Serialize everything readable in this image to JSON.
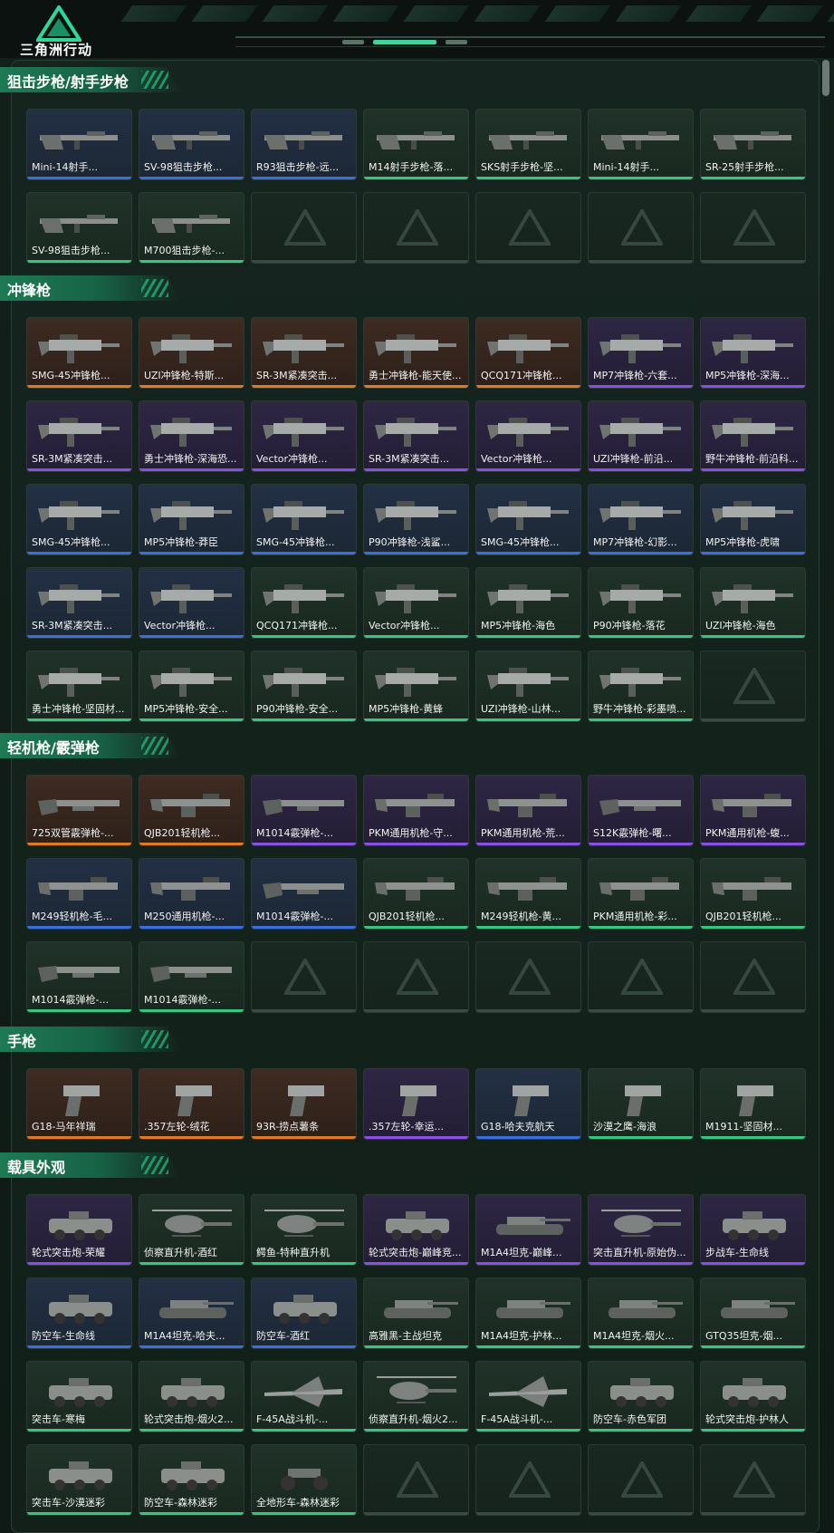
{
  "brand": {
    "logo_text": "三角洲行动"
  },
  "colors": {
    "blue": "#3b6fe0",
    "purple": "#8a50e6",
    "orange": "#e07a25",
    "green": "#39c47f",
    "accent": "#41d39a"
  },
  "sections": [
    {
      "title": "狙击步枪/射手步枪",
      "items": [
        {
          "label": "Mini-14射手...",
          "rarity": "blue",
          "icon": "rifle-icon"
        },
        {
          "label": "SV-98狙击步枪...",
          "rarity": "blue",
          "icon": "rifle-icon"
        },
        {
          "label": "R93狙击步枪-远...",
          "rarity": "blue",
          "icon": "rifle-icon"
        },
        {
          "label": "M14射手步枪-落...",
          "rarity": "green",
          "icon": "rifle-icon"
        },
        {
          "label": "SKS射手步枪-坚...",
          "rarity": "green",
          "icon": "rifle-icon"
        },
        {
          "label": "Mini-14射手...",
          "rarity": "green",
          "icon": "rifle-icon"
        },
        {
          "label": "SR-25射手步枪...",
          "rarity": "green",
          "icon": "rifle-icon"
        },
        {
          "label": "SV-98狙击步枪...",
          "rarity": "green",
          "icon": "rifle-icon"
        },
        {
          "label": "M700狙击步枪-...",
          "rarity": "green",
          "icon": "rifle-icon"
        }
      ]
    },
    {
      "title": "冲锋枪",
      "items": [
        {
          "label": "SMG-45冲锋枪...",
          "rarity": "orange",
          "icon": "smg-icon"
        },
        {
          "label": "UZI冲锋枪-特斯...",
          "rarity": "orange",
          "icon": "smg-icon"
        },
        {
          "label": "SR-3M紧凑突击...",
          "rarity": "orange",
          "icon": "smg-icon"
        },
        {
          "label": "勇士冲锋枪-能天使...",
          "rarity": "orange",
          "icon": "smg-icon"
        },
        {
          "label": "QCQ171冲锋枪...",
          "rarity": "orange",
          "icon": "smg-icon"
        },
        {
          "label": "MP7冲锋枪-六套...",
          "rarity": "purple",
          "icon": "smg-icon"
        },
        {
          "label": "MP5冲锋枪-深海...",
          "rarity": "purple",
          "icon": "smg-icon"
        },
        {
          "label": "SR-3M紧凑突击...",
          "rarity": "purple",
          "icon": "smg-icon"
        },
        {
          "label": "勇士冲锋枪-深海恐...",
          "rarity": "purple",
          "icon": "smg-icon"
        },
        {
          "label": "Vector冲锋枪...",
          "rarity": "purple",
          "icon": "smg-icon"
        },
        {
          "label": "SR-3M紧凑突击...",
          "rarity": "purple",
          "icon": "smg-icon"
        },
        {
          "label": "Vector冲锋枪...",
          "rarity": "purple",
          "icon": "smg-icon"
        },
        {
          "label": "UZI冲锋枪-前沿...",
          "rarity": "purple",
          "icon": "smg-icon"
        },
        {
          "label": "野牛冲锋枪-前沿科...",
          "rarity": "purple",
          "icon": "smg-icon"
        },
        {
          "label": "SMG-45冲锋枪...",
          "rarity": "blue",
          "icon": "smg-icon"
        },
        {
          "label": "MP5冲锋枪-莽臣",
          "rarity": "blue",
          "icon": "smg-icon"
        },
        {
          "label": "SMG-45冲锋枪...",
          "rarity": "blue",
          "icon": "smg-icon"
        },
        {
          "label": "P90冲锋枪-浅鲨...",
          "rarity": "blue",
          "icon": "smg-icon"
        },
        {
          "label": "SMG-45冲锋枪...",
          "rarity": "blue",
          "icon": "smg-icon"
        },
        {
          "label": "MP7冲锋枪-幻影...",
          "rarity": "blue",
          "icon": "smg-icon"
        },
        {
          "label": "MP5冲锋枪-虎啸",
          "rarity": "blue",
          "icon": "smg-icon"
        },
        {
          "label": "SR-3M紧凑突击...",
          "rarity": "blue",
          "icon": "smg-icon"
        },
        {
          "label": "Vector冲锋枪...",
          "rarity": "blue",
          "icon": "smg-icon"
        },
        {
          "label": "QCQ171冲锋枪...",
          "rarity": "green",
          "icon": "smg-icon"
        },
        {
          "label": "Vector冲锋枪...",
          "rarity": "green",
          "icon": "smg-icon"
        },
        {
          "label": "MP5冲锋枪-海色",
          "rarity": "green",
          "icon": "smg-icon"
        },
        {
          "label": "P90冲锋枪-落花",
          "rarity": "green",
          "icon": "smg-icon"
        },
        {
          "label": "UZI冲锋枪-海色",
          "rarity": "green",
          "icon": "smg-icon"
        },
        {
          "label": "勇士冲锋枪-坚固材...",
          "rarity": "green",
          "icon": "smg-icon"
        },
        {
          "label": "MP5冲锋枪-安全...",
          "rarity": "green",
          "icon": "smg-icon"
        },
        {
          "label": "P90冲锋枪-安全...",
          "rarity": "green",
          "icon": "smg-icon"
        },
        {
          "label": "MP5冲锋枪-黄蜂",
          "rarity": "green",
          "icon": "smg-icon"
        },
        {
          "label": "UZI冲锋枪-山林...",
          "rarity": "green",
          "icon": "smg-icon"
        },
        {
          "label": "野牛冲锋枪-彩墨喷...",
          "rarity": "green",
          "icon": "smg-icon"
        }
      ]
    },
    {
      "title": "轻机枪/霰弹枪",
      "items": [
        {
          "label": "725双管霰弹枪-...",
          "rarity": "orange",
          "icon": "shotgun-icon"
        },
        {
          "label": "QJB201轻机枪...",
          "rarity": "orange",
          "icon": "lmg-icon"
        },
        {
          "label": "M1014霰弹枪-...",
          "rarity": "purple",
          "icon": "shotgun-icon"
        },
        {
          "label": "PKM通用机枪-守...",
          "rarity": "purple",
          "icon": "lmg-icon"
        },
        {
          "label": "PKM通用机枪-荒...",
          "rarity": "purple",
          "icon": "lmg-icon"
        },
        {
          "label": "S12K霰弹枪-曙...",
          "rarity": "purple",
          "icon": "shotgun-icon"
        },
        {
          "label": "PKM通用机枪-蝮...",
          "rarity": "purple",
          "icon": "lmg-icon"
        },
        {
          "label": "M249轻机枪-毛...",
          "rarity": "blue",
          "icon": "lmg-icon"
        },
        {
          "label": "M250通用机枪-...",
          "rarity": "blue",
          "icon": "lmg-icon"
        },
        {
          "label": "M1014霰弹枪-...",
          "rarity": "blue",
          "icon": "shotgun-icon"
        },
        {
          "label": "QJB201轻机枪...",
          "rarity": "green",
          "icon": "lmg-icon"
        },
        {
          "label": "M249轻机枪-黄...",
          "rarity": "green",
          "icon": "lmg-icon"
        },
        {
          "label": "PKM通用机枪-彩...",
          "rarity": "green",
          "icon": "lmg-icon"
        },
        {
          "label": "QJB201轻机枪...",
          "rarity": "green",
          "icon": "lmg-icon"
        },
        {
          "label": "M1014霰弹枪-...",
          "rarity": "green",
          "icon": "shotgun-icon"
        },
        {
          "label": "M1014霰弹枪-...",
          "rarity": "green",
          "icon": "shotgun-icon"
        }
      ]
    },
    {
      "title": "手枪",
      "items": [
        {
          "label": "G18-马年祥瑞",
          "rarity": "orange",
          "icon": "pistol-icon"
        },
        {
          "label": ".357左轮-绒花",
          "rarity": "orange",
          "icon": "pistol-icon"
        },
        {
          "label": "93R-捞点薯条",
          "rarity": "orange",
          "icon": "pistol-icon"
        },
        {
          "label": ".357左轮-幸运...",
          "rarity": "purple",
          "icon": "pistol-icon"
        },
        {
          "label": "G18-哈夫克航天",
          "rarity": "blue",
          "icon": "pistol-icon"
        },
        {
          "label": "沙漠之鹰-海浪",
          "rarity": "green",
          "icon": "pistol-icon"
        },
        {
          "label": "M1911-坚固材...",
          "rarity": "green",
          "icon": "pistol-icon"
        }
      ]
    },
    {
      "title": "载具外观",
      "items": [
        {
          "label": "轮式突击炮-荣耀",
          "rarity": "purple",
          "icon": "vehicle-icon"
        },
        {
          "label": "侦察直升机-酒红",
          "rarity": "green",
          "icon": "helicopter-icon"
        },
        {
          "label": "鳄鱼-特种直升机",
          "rarity": "green",
          "icon": "helicopter-icon"
        },
        {
          "label": "轮式突击炮-巅峰竞...",
          "rarity": "purple",
          "icon": "vehicle-icon"
        },
        {
          "label": "M1A4坦克-巅峰...",
          "rarity": "purple",
          "icon": "tank-icon"
        },
        {
          "label": "突击直升机-原始伪...",
          "rarity": "purple",
          "icon": "helicopter-icon"
        },
        {
          "label": "步战车-生命线",
          "rarity": "purple",
          "icon": "vehicle-icon"
        },
        {
          "label": "防空车-生命线",
          "rarity": "blue",
          "icon": "vehicle-icon"
        },
        {
          "label": "M1A4坦克-哈夫...",
          "rarity": "blue",
          "icon": "tank-icon"
        },
        {
          "label": "防空车-酒红",
          "rarity": "blue",
          "icon": "vehicle-icon"
        },
        {
          "label": "高雅黑-主战坦克",
          "rarity": "green",
          "icon": "tank-icon"
        },
        {
          "label": "M1A4坦克-护林...",
          "rarity": "green",
          "icon": "tank-icon"
        },
        {
          "label": "M1A4坦克-烟火...",
          "rarity": "green",
          "icon": "tank-icon"
        },
        {
          "label": "GTQ35坦克-烟...",
          "rarity": "green",
          "icon": "tank-icon"
        },
        {
          "label": "突击车-寒梅",
          "rarity": "green",
          "icon": "vehicle-icon"
        },
        {
          "label": "轮式突击炮-烟火2...",
          "rarity": "green",
          "icon": "vehicle-icon"
        },
        {
          "label": "F-45A战斗机-...",
          "rarity": "green",
          "icon": "jet-icon"
        },
        {
          "label": "侦察直升机-烟火2...",
          "rarity": "green",
          "icon": "helicopter-icon"
        },
        {
          "label": "F-45A战斗机-...",
          "rarity": "green",
          "icon": "jet-icon"
        },
        {
          "label": "防空车-赤色军团",
          "rarity": "green",
          "icon": "vehicle-icon"
        },
        {
          "label": "轮式突击炮-护林人",
          "rarity": "green",
          "icon": "vehicle-icon"
        },
        {
          "label": "突击车-沙漠迷彩",
          "rarity": "green",
          "icon": "vehicle-icon"
        },
        {
          "label": "防空车-森林迷彩",
          "rarity": "green",
          "icon": "vehicle-icon"
        },
        {
          "label": "全地形车-森林迷彩",
          "rarity": "green",
          "icon": "atv-icon"
        }
      ]
    }
  ]
}
